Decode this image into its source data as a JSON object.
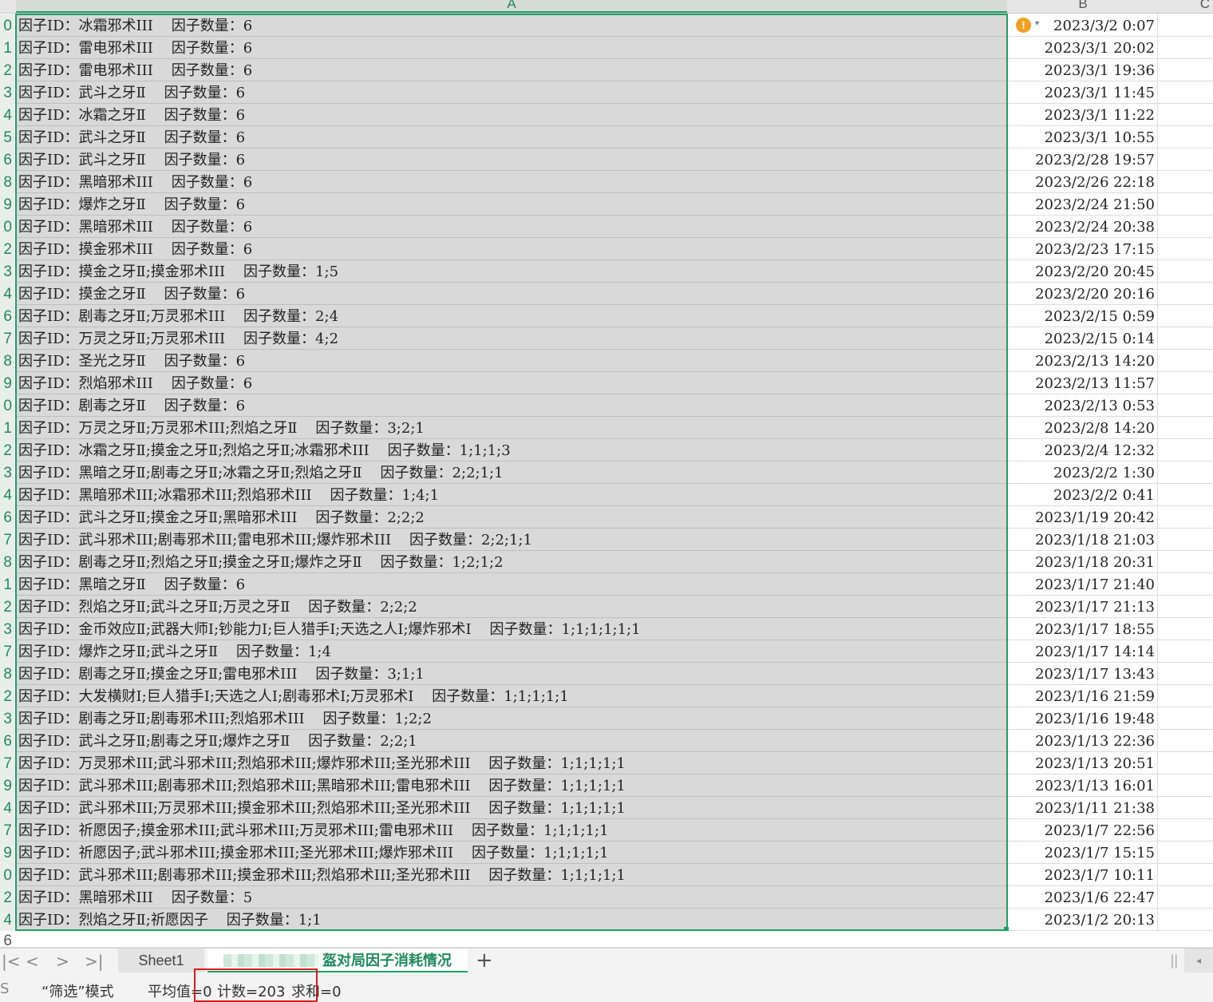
{
  "columns": {
    "a": "A",
    "b": "B",
    "c": "C"
  },
  "rows": [
    {
      "rn": "0",
      "a": "因子ID：冰霜邪术III    因子数量：6",
      "b": "2023/3/2  0:07"
    },
    {
      "rn": "1",
      "a": "因子ID：雷电邪术III    因子数量：6",
      "b": "2023/3/1  20:02"
    },
    {
      "rn": "2",
      "a": "因子ID：雷电邪术III    因子数量：6",
      "b": "2023/3/1  19:36"
    },
    {
      "rn": "3",
      "a": "因子ID：武斗之牙Ⅱ    因子数量：6",
      "b": "2023/3/1  11:45"
    },
    {
      "rn": "4",
      "a": "因子ID：冰霜之牙Ⅱ    因子数量：6",
      "b": "2023/3/1  11:22"
    },
    {
      "rn": "5",
      "a": "因子ID：武斗之牙Ⅱ    因子数量：6",
      "b": "2023/3/1  10:55"
    },
    {
      "rn": "6",
      "a": "因子ID：武斗之牙Ⅱ    因子数量：6",
      "b": "2023/2/28  19:57"
    },
    {
      "rn": "8",
      "a": "因子ID：黑暗邪术III    因子数量：6",
      "b": "2023/2/26  22:18"
    },
    {
      "rn": "9",
      "a": "因子ID：爆炸之牙Ⅱ    因子数量：6",
      "b": "2023/2/24  21:50"
    },
    {
      "rn": "0",
      "a": "因子ID：黑暗邪术III    因子数量：6",
      "b": "2023/2/24  20:38"
    },
    {
      "rn": "2",
      "a": "因子ID：摸金邪术III    因子数量：6",
      "b": "2023/2/23  17:15"
    },
    {
      "rn": "3",
      "a": "因子ID：摸金之牙Ⅱ;摸金邪术III    因子数量：1;5",
      "b": "2023/2/20  20:45"
    },
    {
      "rn": "4",
      "a": "因子ID：摸金之牙Ⅱ    因子数量：6",
      "b": "2023/2/20  20:16"
    },
    {
      "rn": "6",
      "a": "因子ID：剧毒之牙Ⅱ;万灵邪术III    因子数量：2;4",
      "b": "2023/2/15  0:59"
    },
    {
      "rn": "7",
      "a": "因子ID：万灵之牙Ⅱ;万灵邪术III    因子数量：4;2",
      "b": "2023/2/15  0:14"
    },
    {
      "rn": "8",
      "a": "因子ID：圣光之牙Ⅱ    因子数量：6",
      "b": "2023/2/13  14:20"
    },
    {
      "rn": "9",
      "a": "因子ID：烈焰邪术III    因子数量：6",
      "b": "2023/2/13  11:57"
    },
    {
      "rn": "0",
      "a": "因子ID：剧毒之牙Ⅱ    因子数量：6",
      "b": "2023/2/13  0:53"
    },
    {
      "rn": "1",
      "a": "因子ID：万灵之牙Ⅱ;万灵邪术III;烈焰之牙Ⅱ    因子数量：3;2;1",
      "b": "2023/2/8  14:20"
    },
    {
      "rn": "2",
      "a": "因子ID：冰霜之牙Ⅱ;摸金之牙Ⅱ;烈焰之牙Ⅱ;冰霜邪术III    因子数量：1;1;1;3",
      "b": "2023/2/4  12:32"
    },
    {
      "rn": "3",
      "a": "因子ID：黑暗之牙Ⅱ;剧毒之牙Ⅱ;冰霜之牙Ⅱ;烈焰之牙Ⅱ    因子数量：2;2;1;1",
      "b": "2023/2/2  1:30"
    },
    {
      "rn": "4",
      "a": "因子ID：黑暗邪术III;冰霜邪术III;烈焰邪术III    因子数量：1;4;1",
      "b": "2023/2/2  0:41"
    },
    {
      "rn": "6",
      "a": "因子ID：武斗之牙Ⅱ;摸金之牙Ⅱ;黑暗邪术III    因子数量：2;2;2",
      "b": "2023/1/19  20:42"
    },
    {
      "rn": "7",
      "a": "因子ID：武斗邪术III;剧毒邪术III;雷电邪术III;爆炸邪术III    因子数量：2;2;1;1",
      "b": "2023/1/18  21:03"
    },
    {
      "rn": "8",
      "a": "因子ID：剧毒之牙Ⅱ;烈焰之牙Ⅱ;摸金之牙Ⅱ;爆炸之牙Ⅱ    因子数量：1;2;1;2",
      "b": "2023/1/18  20:31"
    },
    {
      "rn": "1",
      "a": "因子ID：黑暗之牙Ⅱ    因子数量：6",
      "b": "2023/1/17  21:40"
    },
    {
      "rn": "2",
      "a": "因子ID：烈焰之牙Ⅱ;武斗之牙Ⅱ;万灵之牙Ⅱ    因子数量：2;2;2",
      "b": "2023/1/17  21:13"
    },
    {
      "rn": "3",
      "a": "因子ID：金币效应Ⅱ;武器大师Ⅰ;钞能力Ⅰ;巨人猎手Ⅰ;天选之人Ⅰ;爆炸邪术Ⅰ    因子数量：1;1;1;1;1;1",
      "b": "2023/1/17  18:55"
    },
    {
      "rn": "7",
      "a": "因子ID：爆炸之牙Ⅱ;武斗之牙Ⅱ    因子数量：1;4",
      "b": "2023/1/17  14:14"
    },
    {
      "rn": "8",
      "a": "因子ID：剧毒之牙Ⅱ;摸金之牙Ⅱ;雷电邪术III    因子数量：3;1;1",
      "b": "2023/1/17  13:43"
    },
    {
      "rn": "2",
      "a": "因子ID：大发横财Ⅰ;巨人猎手Ⅰ;天选之人Ⅰ;剧毒邪术Ⅰ;万灵邪术Ⅰ    因子数量：1;1;1;1;1",
      "b": "2023/1/16  21:59"
    },
    {
      "rn": "3",
      "a": "因子ID：剧毒之牙Ⅱ;剧毒邪术III;烈焰邪术III    因子数量：1;2;2",
      "b": "2023/1/16  19:48"
    },
    {
      "rn": "6",
      "a": "因子ID：武斗之牙Ⅱ;剧毒之牙Ⅱ;爆炸之牙Ⅱ    因子数量：2;2;1",
      "b": "2023/1/13  22:36"
    },
    {
      "rn": "7",
      "a": "因子ID：万灵邪术III;武斗邪术III;烈焰邪术III;爆炸邪术III;圣光邪术III    因子数量：1;1;1;1;1",
      "b": "2023/1/13  20:51"
    },
    {
      "rn": "9",
      "a": "因子ID：武斗邪术III;剧毒邪术III;烈焰邪术III;黑暗邪术III;雷电邪术III    因子数量：1;1;1;1;1",
      "b": "2023/1/13  16:01"
    },
    {
      "rn": "4",
      "a": "因子ID：武斗邪术III;万灵邪术III;摸金邪术III;烈焰邪术III;圣光邪术III    因子数量：1;1;1;1;1",
      "b": "2023/1/11  21:38"
    },
    {
      "rn": "7",
      "a": "因子ID：祈愿因子;摸金邪术III;武斗邪术III;万灵邪术III;雷电邪术III    因子数量：1;1;1;1;1",
      "b": "2023/1/7  22:56"
    },
    {
      "rn": "9",
      "a": "因子ID：祈愿因子;武斗邪术III;摸金邪术III;圣光邪术III;爆炸邪术III    因子数量：1;1;1;1;1",
      "b": "2023/1/7  15:15"
    },
    {
      "rn": "0",
      "a": "因子ID：武斗邪术III;剧毒邪术III;摸金邪术III;烈焰邪术III;圣光邪术III    因子数量：1;1;1;1;1",
      "b": "2023/1/7  10:11"
    },
    {
      "rn": "2",
      "a": "因子ID：黑暗邪术III    因子数量：5",
      "b": "2023/1/6  22:47"
    },
    {
      "rn": "4",
      "a": "因子ID：烈焰之牙Ⅱ;祈愿因子    因子数量：1;1",
      "b": "2023/1/2  20:13"
    }
  ],
  "partial_row_number": "6",
  "warning": {
    "glyph": "!",
    "caret": "▾"
  },
  "nav": {
    "first": "|<",
    "prev": "<",
    "next": ">",
    "last": ">|"
  },
  "tabs": {
    "sheet1": "Sheet1",
    "active_suffix": "盔对局因子消耗情况",
    "add": "+"
  },
  "status": {
    "left_cut": "S",
    "mode": "“筛选”模式",
    "average": "平均值=0",
    "count": "计数=203",
    "sum": "求和=0"
  },
  "colors": {
    "selection": "#1f9e64",
    "highlight_box": "#d01f1f",
    "warning": "#f0a020"
  }
}
